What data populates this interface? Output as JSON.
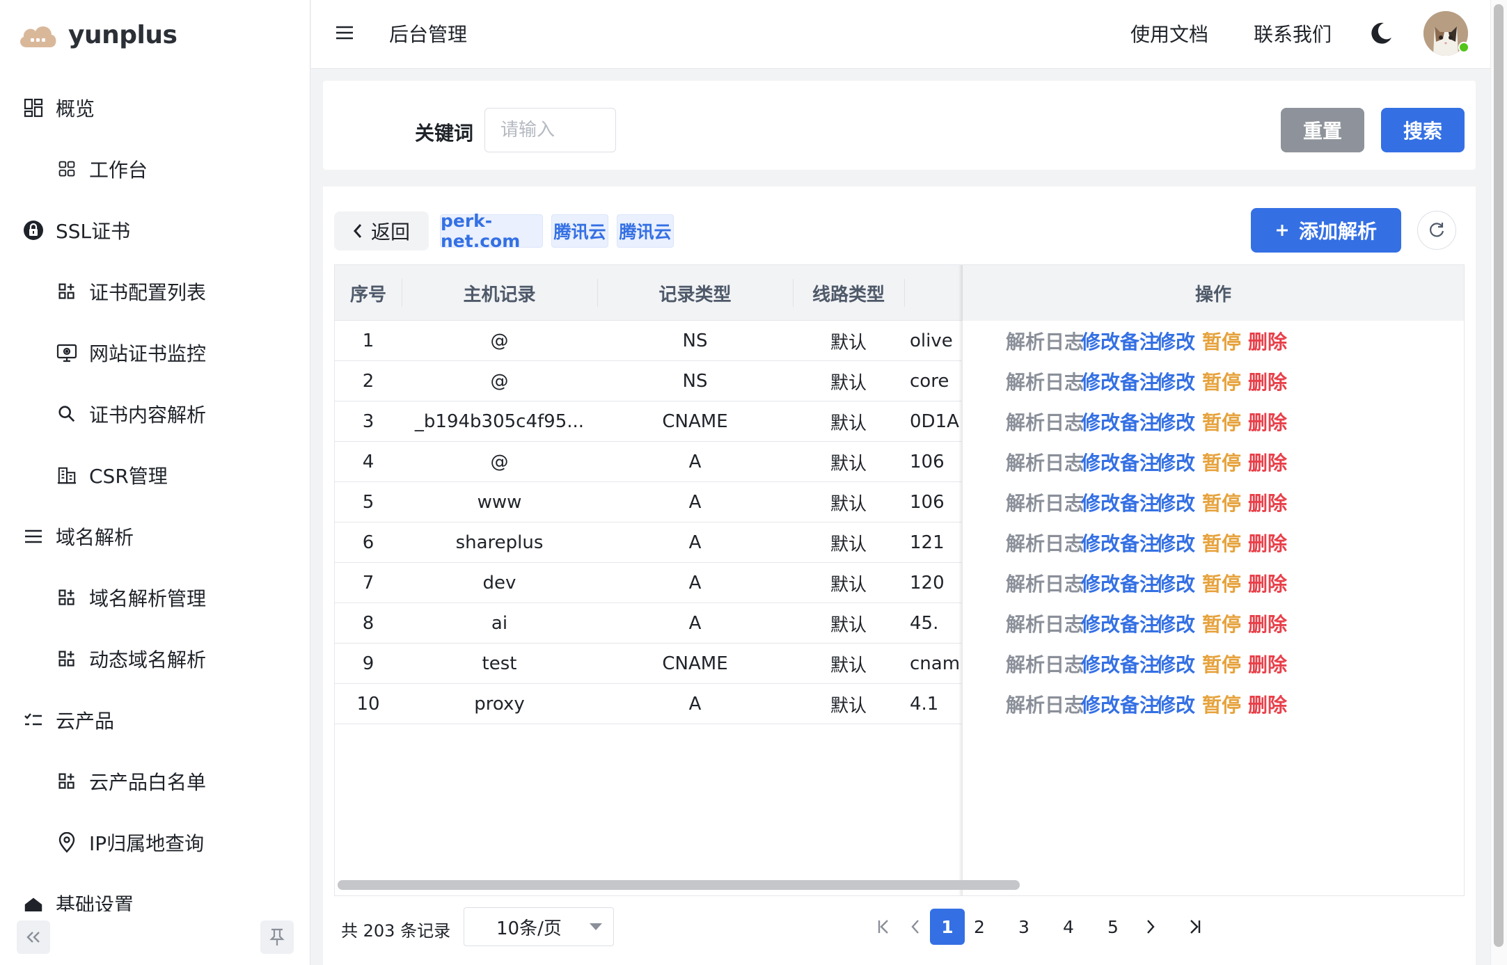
{
  "brand": {
    "name": "yunplus"
  },
  "sidebar": {
    "items": [
      {
        "label": "概览",
        "icon": "overview-grid-icon",
        "level": "group"
      },
      {
        "label": "工作台",
        "icon": "dashboard-grid-icon",
        "level": "sub"
      },
      {
        "label": "SSL证书",
        "icon": "lock-icon",
        "level": "group"
      },
      {
        "label": "证书配置列表",
        "icon": "apps-icon",
        "level": "sub"
      },
      {
        "label": "网站证书监控",
        "icon": "monitor-icon",
        "level": "sub"
      },
      {
        "label": "证书内容解析",
        "icon": "search-icon",
        "level": "sub"
      },
      {
        "label": "CSR管理",
        "icon": "building-icon",
        "level": "sub"
      },
      {
        "label": "域名解析",
        "icon": "list-icon",
        "level": "group"
      },
      {
        "label": "域名解析管理",
        "icon": "apps-icon",
        "level": "sub"
      },
      {
        "label": "动态域名解析",
        "icon": "apps-icon",
        "level": "sub"
      },
      {
        "label": "云产品",
        "icon": "checklist-icon",
        "level": "group"
      },
      {
        "label": "云产品白名单",
        "icon": "apps-icon",
        "level": "sub"
      },
      {
        "label": "IP归属地查询",
        "icon": "location-pin-icon",
        "level": "sub"
      },
      {
        "label": "基础设置",
        "icon": "settings-icon",
        "level": "group"
      }
    ]
  },
  "header": {
    "title": "后台管理",
    "docs_link": "使用文档",
    "contact_link": "联系我们"
  },
  "search": {
    "keyword_label": "关键词",
    "keyword_placeholder": "请输入",
    "reset_label": "重置",
    "search_label": "搜索"
  },
  "toolbar": {
    "back_label": "返回",
    "domain_tag": "perk-net.com",
    "provider_tag_1": "腾讯云",
    "provider_tag_2": "腾讯云",
    "add_label": "添加解析"
  },
  "table": {
    "columns": {
      "index": "序号",
      "host": "主机记录",
      "type": "记录类型",
      "line": "线路类型",
      "actions": "操作"
    },
    "rows": [
      {
        "index": "1",
        "host": "@",
        "type": "NS",
        "line": "默认",
        "value": "olive"
      },
      {
        "index": "2",
        "host": "@",
        "type": "NS",
        "line": "默认",
        "value": "core"
      },
      {
        "index": "3",
        "host": "_b194b305c4f95...",
        "type": "CNAME",
        "line": "默认",
        "value": "0D1A"
      },
      {
        "index": "4",
        "host": "@",
        "type": "A",
        "line": "默认",
        "value": "106"
      },
      {
        "index": "5",
        "host": "www",
        "type": "A",
        "line": "默认",
        "value": "106"
      },
      {
        "index": "6",
        "host": "shareplus",
        "type": "A",
        "line": "默认",
        "value": "121"
      },
      {
        "index": "7",
        "host": "dev",
        "type": "A",
        "line": "默认",
        "value": "120"
      },
      {
        "index": "8",
        "host": "ai",
        "type": "A",
        "line": "默认",
        "value": "45."
      },
      {
        "index": "9",
        "host": "test",
        "type": "CNAME",
        "line": "默认",
        "value": "cnam"
      },
      {
        "index": "10",
        "host": "proxy",
        "type": "A",
        "line": "默认",
        "value": "4.1"
      }
    ],
    "actions": {
      "log": "解析日志",
      "edit_remark": "修改备注",
      "edit": "修改",
      "pause": "暂停",
      "delete": "删除"
    }
  },
  "pagination": {
    "total_text": "共 203 条记录",
    "page_size": "10条/页",
    "pages": [
      "1",
      "2",
      "3",
      "4",
      "5"
    ],
    "current": "1"
  },
  "colors": {
    "primary": "#3470e4",
    "reset_gray": "#8e939b",
    "warn": "#e6a23c",
    "danger": "#e8404a",
    "muted": "#8a8f99"
  }
}
